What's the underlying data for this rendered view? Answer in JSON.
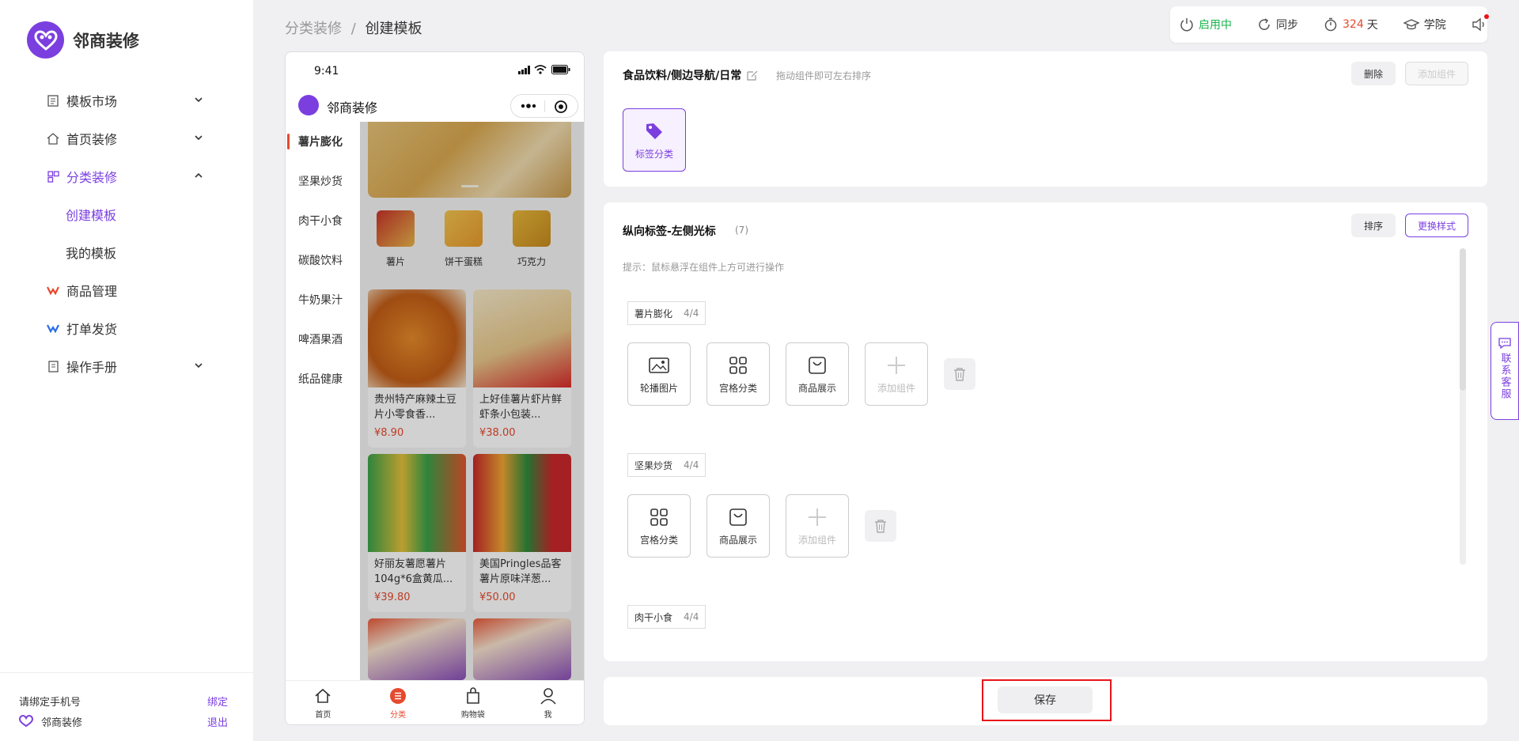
{
  "brand": {
    "name": "邻商装修",
    "color": "#7b3fe0"
  },
  "sidebar": {
    "items": [
      {
        "label": "模板市场",
        "icon": "template-market-icon",
        "expandable": true
      },
      {
        "label": "首页装修",
        "icon": "home-icon",
        "expandable": true
      },
      {
        "label": "分类装修",
        "icon": "category-icon",
        "expandable": true,
        "expanded": true,
        "children": [
          {
            "label": "创建模板",
            "active": true
          },
          {
            "label": "我的模板"
          }
        ]
      },
      {
        "label": "商品管理",
        "icon": "goods-icon"
      },
      {
        "label": "打单发货",
        "icon": "shipping-icon"
      },
      {
        "label": "操作手册",
        "icon": "manual-icon",
        "expandable": true
      }
    ],
    "bottom": {
      "bind_phone": "请绑定手机号",
      "bind_link": "绑定",
      "account": "邻商装修",
      "logout": "退出"
    }
  },
  "breadcrumb": {
    "parent": "分类装修",
    "sep": "/",
    "current": "创建模板"
  },
  "topbar": {
    "status": "启用中",
    "status_color": "#19b34c",
    "sync": "同步",
    "days_value": "324",
    "days_unit": "天",
    "days_color": "#e64a2e",
    "academy": "学院"
  },
  "phone": {
    "time": "9:41",
    "app_title": "邻商装修",
    "categories": [
      "薯片膨化",
      "坚果炒货",
      "肉干小食",
      "碳酸饮料",
      "牛奶果汁",
      "啤酒果酒",
      "纸品健康"
    ],
    "icons": [
      "薯片",
      "饼干蛋糕",
      "巧克力"
    ],
    "products": [
      {
        "name": "贵州特产麻辣土豆片小零食香...",
        "price": "¥8.90"
      },
      {
        "name": "上好佳薯片虾片鲜虾条小包装...",
        "price": "¥38.00"
      },
      {
        "name": "好丽友薯愿薯片104g*6盒黄瓜...",
        "price": "¥39.80"
      },
      {
        "name": "美国Pringles品客薯片原味洋葱...",
        "price": "¥50.00"
      }
    ],
    "tabs": [
      "首页",
      "分类",
      "购物袋",
      "我"
    ]
  },
  "panel1": {
    "title": "食品饮料/侧边导航/日常",
    "hint": "拖动组件即可左右排序",
    "delete": "删除",
    "add": "添加组件",
    "component": "标签分类"
  },
  "panel2": {
    "title": "纵向标签-左侧光标",
    "count": "(7)",
    "sort": "排序",
    "change_style": "更换样式",
    "hint": "提示：鼠标悬浮在组件上方可进行操作",
    "sections": [
      {
        "name": "薯片膨化",
        "count": "4/4",
        "components": [
          "轮播图片",
          "宫格分类",
          "商品展示"
        ]
      },
      {
        "name": "坚果炒货",
        "count": "4/4",
        "components": [
          "宫格分类",
          "商品展示"
        ]
      },
      {
        "name": "肉干小食",
        "count": "4/4",
        "components": []
      }
    ],
    "add_component": "添加组件"
  },
  "save": "保存",
  "customer_service": "联系客服"
}
